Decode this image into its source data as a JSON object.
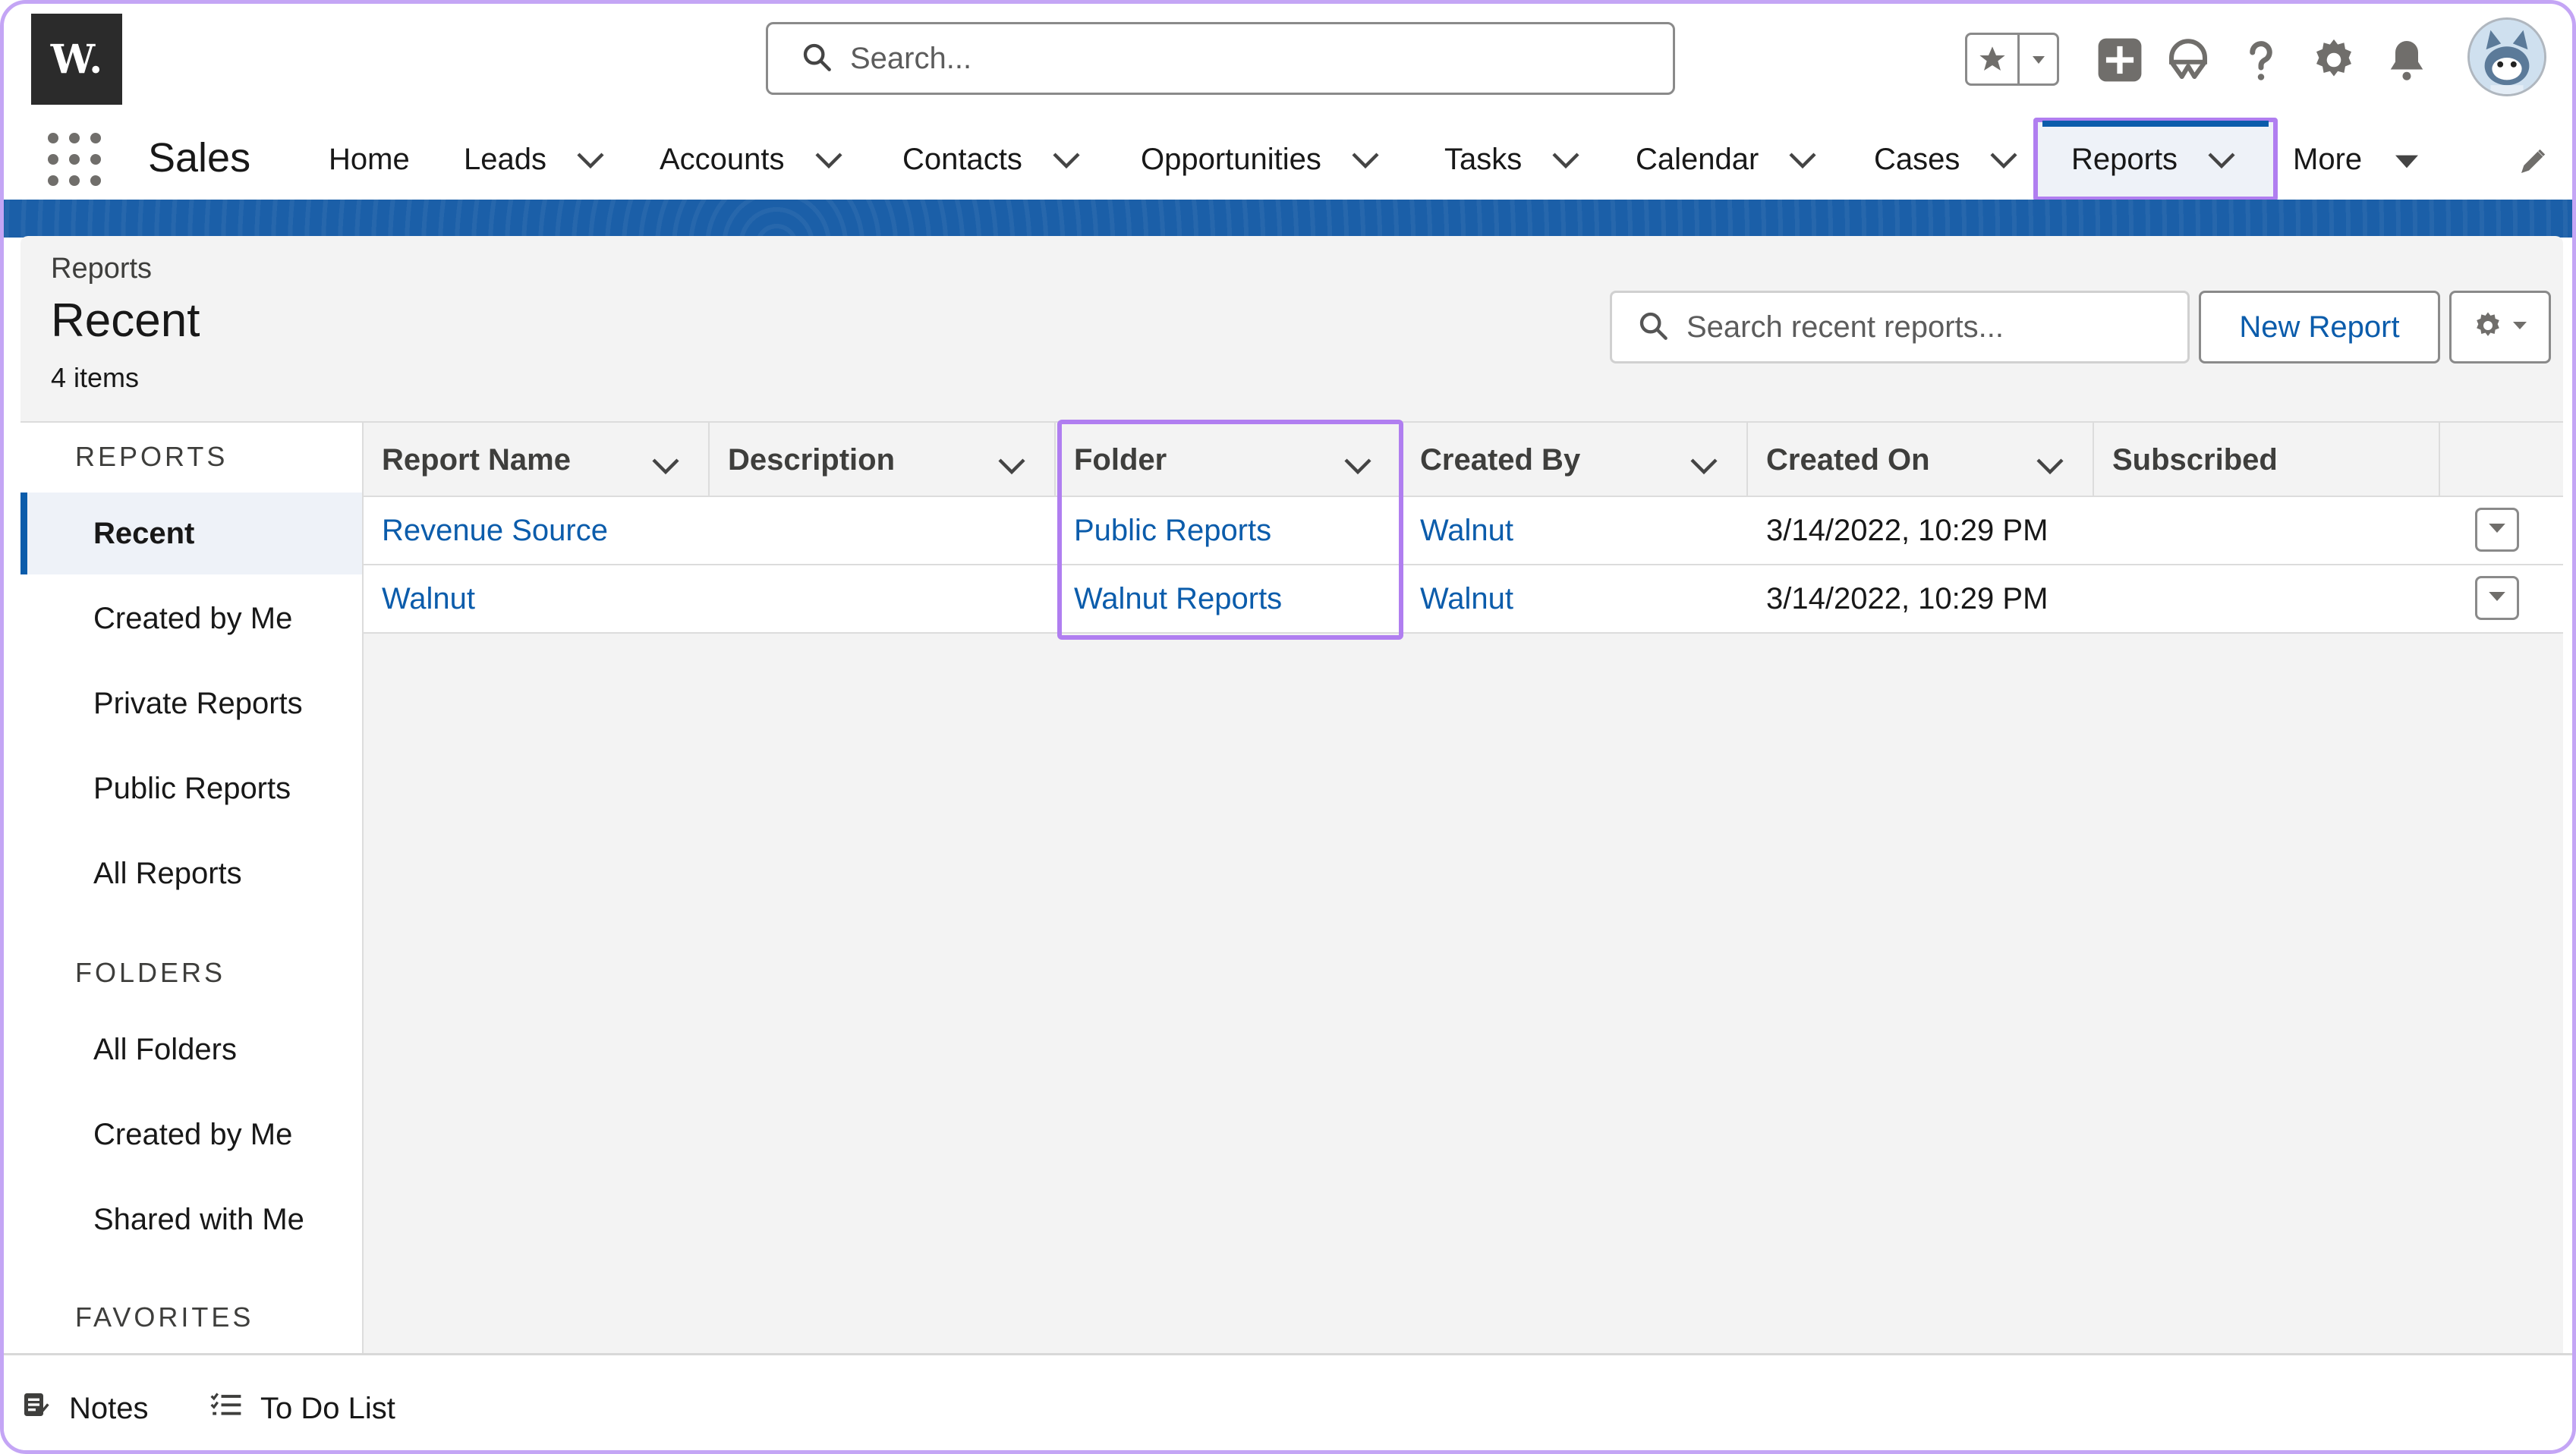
{
  "header": {
    "logo_text": "W.",
    "search_placeholder": "Search...",
    "icons": [
      "favorites-star-icon",
      "favorites-dropdown-icon",
      "global-create-icon",
      "trailhead-icon",
      "help-icon",
      "setup-gear-icon",
      "notifications-bell-icon",
      "user-avatar"
    ]
  },
  "nav": {
    "app_name": "Sales",
    "items": [
      {
        "label": "Home",
        "has_menu": false
      },
      {
        "label": "Leads",
        "has_menu": true
      },
      {
        "label": "Accounts",
        "has_menu": true
      },
      {
        "label": "Contacts",
        "has_menu": true
      },
      {
        "label": "Opportunities",
        "has_menu": true
      },
      {
        "label": "Tasks",
        "has_menu": true
      },
      {
        "label": "Calendar",
        "has_menu": true
      },
      {
        "label": "Cases",
        "has_menu": true
      },
      {
        "label": "Reports",
        "has_menu": true,
        "active": true
      },
      {
        "label": "More",
        "has_menu": true
      }
    ]
  },
  "page": {
    "breadcrumb": "Reports",
    "title": "Recent",
    "item_count": "4 items",
    "search_placeholder": "Search recent reports...",
    "new_report_label": "New Report"
  },
  "sidebar": {
    "sections": [
      {
        "heading": "REPORTS",
        "items": [
          "Recent",
          "Created by Me",
          "Private Reports",
          "Public Reports",
          "All Reports"
        ]
      },
      {
        "heading": "FOLDERS",
        "items": [
          "All Folders",
          "Created by Me",
          "Shared with Me"
        ]
      },
      {
        "heading": "FAVORITES",
        "items": []
      }
    ],
    "active_item": "Recent"
  },
  "table": {
    "columns": [
      "Report Name",
      "Description",
      "Folder",
      "Created By",
      "Created On",
      "Subscribed"
    ],
    "rows": [
      {
        "report_name": "Revenue Source",
        "description": "",
        "folder": "Public Reports",
        "created_by": "Walnut",
        "created_on": "3/14/2022, 10:29 PM",
        "subscribed": ""
      },
      {
        "report_name": "Walnut",
        "description": "",
        "folder": "Walnut Reports",
        "created_by": "Walnut",
        "created_on": "3/14/2022, 10:29 PM",
        "subscribed": ""
      }
    ]
  },
  "utility_bar": {
    "items": [
      "Notes",
      "To Do List"
    ]
  },
  "colors": {
    "brand_blue": "#0b5cab",
    "band_blue": "#1b5fa8",
    "highlight_purple": "#b07ef0",
    "frame_purple": "#c4a5f5"
  }
}
